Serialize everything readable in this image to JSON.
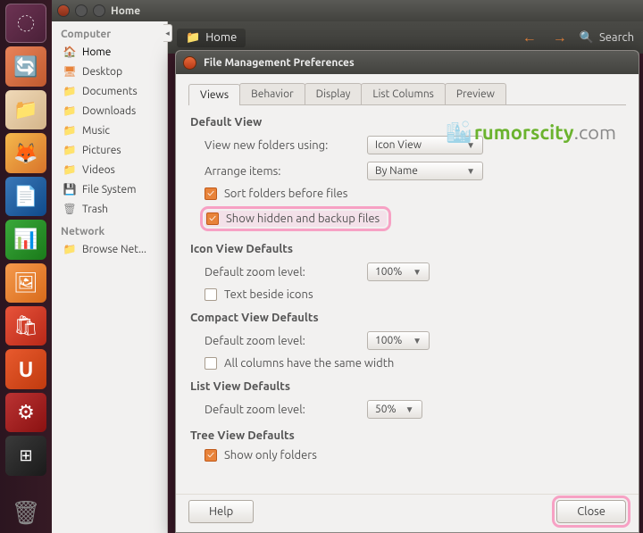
{
  "window": {
    "title": "Home"
  },
  "sidebar": {
    "header1": "Computer",
    "items1": [
      {
        "label": "Home",
        "icon": "folder"
      },
      {
        "label": "Desktop",
        "icon": "folder"
      },
      {
        "label": "Documents",
        "icon": "folder"
      },
      {
        "label": "Downloads",
        "icon": "folder"
      },
      {
        "label": "Music",
        "icon": "folder"
      },
      {
        "label": "Pictures",
        "icon": "folder"
      },
      {
        "label": "Videos",
        "icon": "folder"
      },
      {
        "label": "File System",
        "icon": "drive"
      },
      {
        "label": "Trash",
        "icon": "drive"
      }
    ],
    "header2": "Network",
    "items2": [
      {
        "label": "Browse Net...",
        "icon": "folder"
      }
    ]
  },
  "toolbar": {
    "home": "Home",
    "search": "Search"
  },
  "dialog": {
    "title": "File Management Preferences",
    "tabs": [
      "Views",
      "Behavior",
      "Display",
      "List Columns",
      "Preview"
    ],
    "default_view": {
      "title": "Default View",
      "view_new_label": "View new folders using:",
      "view_new_value": "Icon View",
      "arrange_label": "Arrange items:",
      "arrange_value": "By Name",
      "sort_folders": "Sort folders before files",
      "show_hidden": "Show hidden and backup files"
    },
    "icon_view": {
      "title": "Icon View Defaults",
      "zoom_label": "Default zoom level:",
      "zoom_value": "100%",
      "text_beside": "Text beside icons"
    },
    "compact_view": {
      "title": "Compact View Defaults",
      "zoom_label": "Default zoom level:",
      "zoom_value": "100%",
      "same_width": "All columns have the same width"
    },
    "list_view": {
      "title": "List View Defaults",
      "zoom_label": "Default zoom level:",
      "zoom_value": "50%"
    },
    "tree_view": {
      "title": "Tree View Defaults",
      "show_only_folders": "Show only folders"
    },
    "help": "Help",
    "close": "Close"
  },
  "watermark": {
    "brand": "rumorscity",
    "domain": ".com"
  }
}
